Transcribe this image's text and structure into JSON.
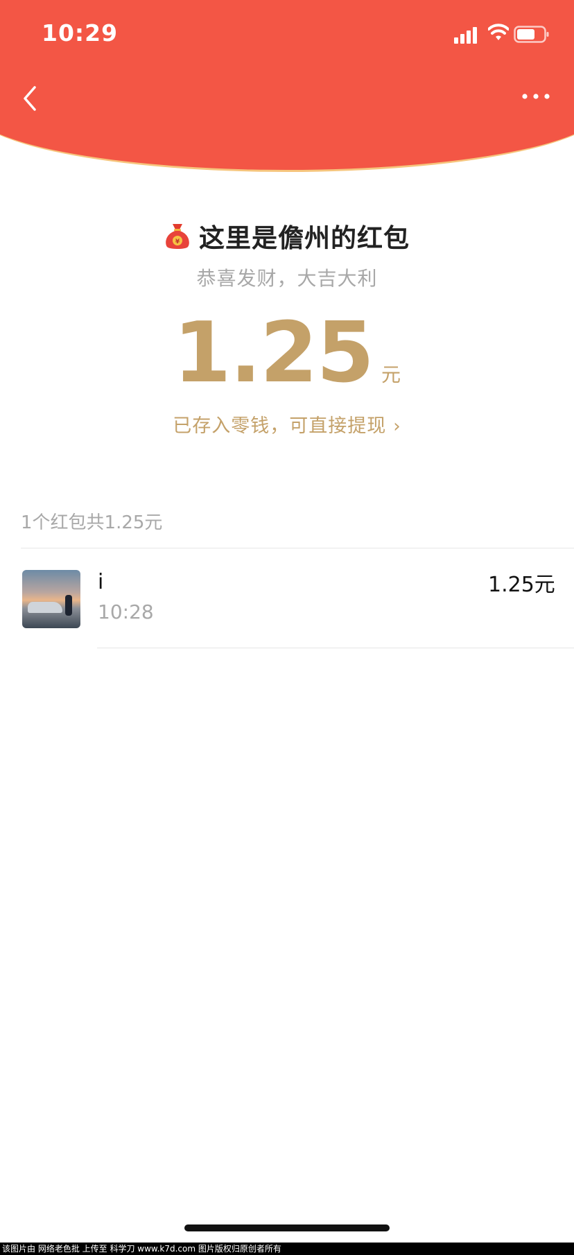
{
  "status_bar": {
    "time": "10:29",
    "icons": [
      "cellular-signal-icon",
      "wifi-icon",
      "battery-icon"
    ]
  },
  "nav": {
    "back_icon": "chevron-left-icon",
    "more_icon": "more-dots-icon"
  },
  "packet": {
    "title": "这里是儋州的红包",
    "icon": "money-bag-icon",
    "subtitle": "恭喜发财，大吉大利",
    "amount": "1.25",
    "unit": "元",
    "withdraw_text": "已存入零钱，可直接提现",
    "withdraw_chevron": "›"
  },
  "summary": "1个红包共1.25元",
  "records": [
    {
      "name": "i",
      "time": "10:28",
      "amount": "1.25元"
    }
  ],
  "watermark": "该图片由 网络老色批 上传至 科学刀 www.k7d.com 图片版权归原创者所有",
  "colors": {
    "header_red": "#f35645",
    "header_border": "#f6c57d",
    "gold": "#c4a169",
    "gray_text": "#a8a8a8"
  }
}
